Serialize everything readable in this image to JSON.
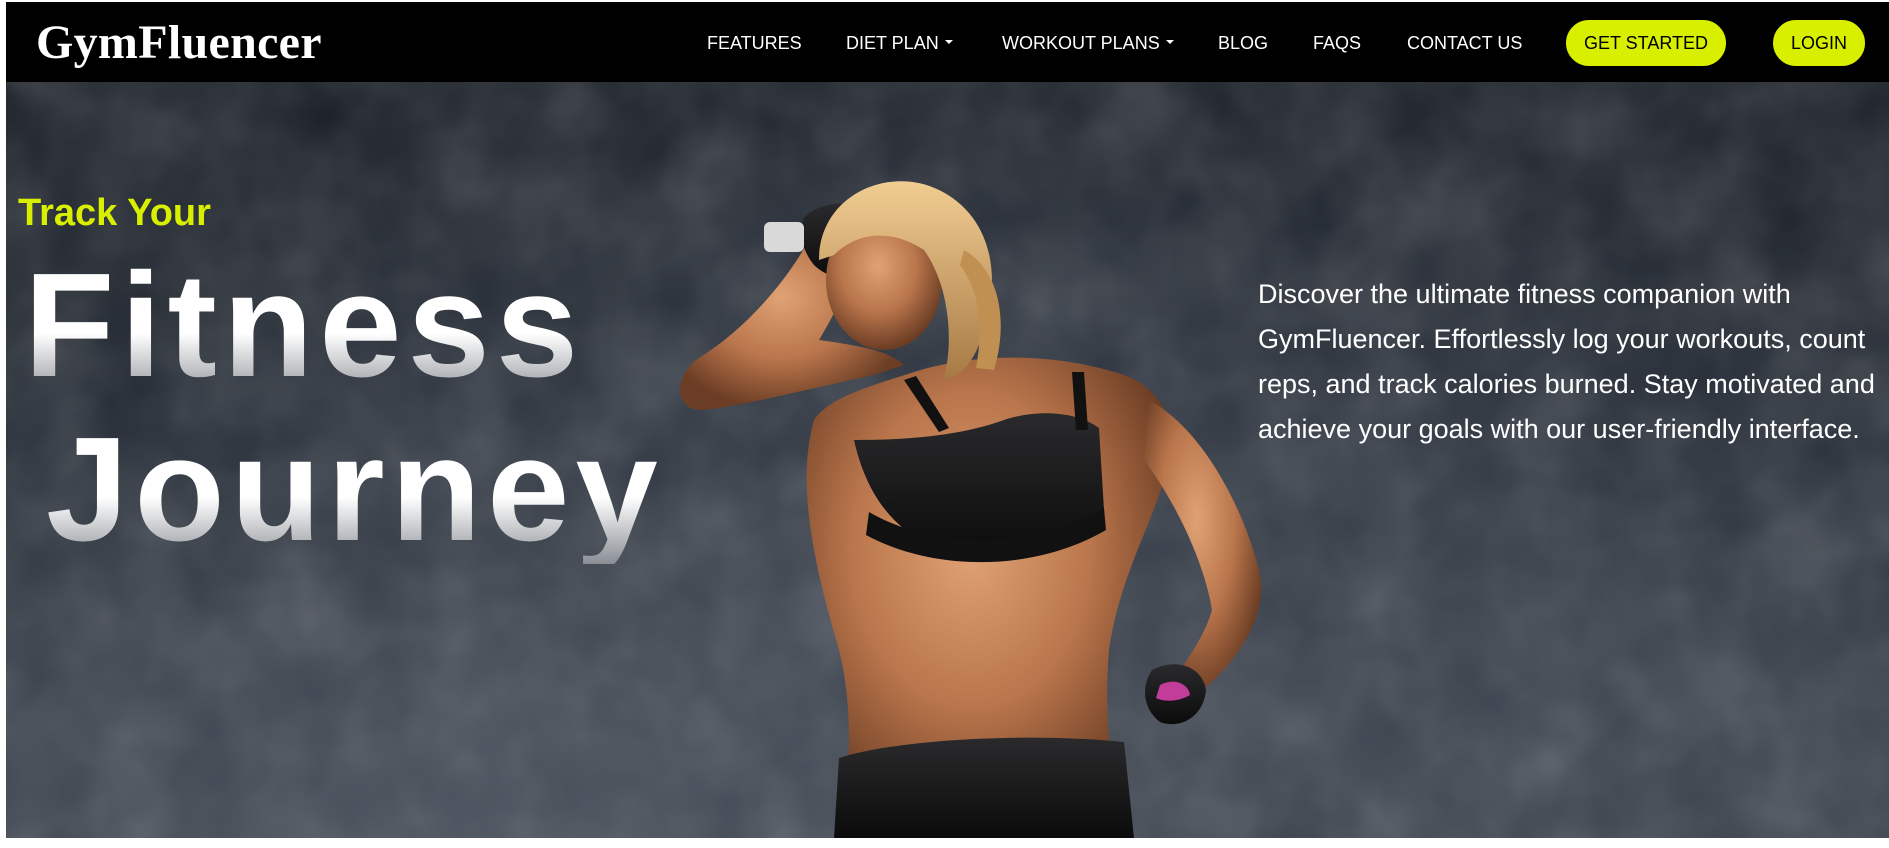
{
  "header": {
    "brand": "GymFluencer",
    "nav": {
      "features": "FEATURES",
      "diet_plan": "DIET PLAN",
      "workout_plans": "WORKOUT PLANS",
      "blog": "BLOG",
      "faqs": "FAQS",
      "contact_us": "CONTACT US"
    },
    "get_started": "GET STARTED",
    "login": "LOGIN"
  },
  "hero": {
    "kicker": "Track Your",
    "headline_line1": "Fitness",
    "headline_line2": "Journey",
    "description": "Discover the ultimate fitness companion with GymFluencer. Effortlessly log your workouts, count reps, and track calories burned. Stay motivated and achieve your goals with our user-friendly interface.",
    "image_subject": "woman-flexing-biceps-photo"
  },
  "colors": {
    "accent": "#d8f000",
    "nav_background": "#000000",
    "hero_background": "#232a34",
    "text": "#ffffff"
  }
}
